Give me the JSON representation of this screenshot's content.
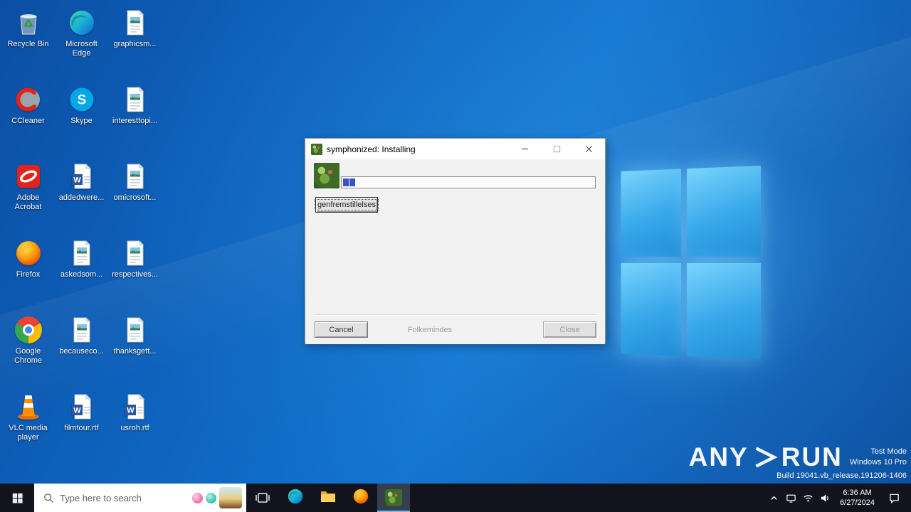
{
  "desktop": {
    "icons": [
      {
        "id": "recycle-bin",
        "label": "Recycle Bin",
        "icon": "recycle-bin-icon"
      },
      {
        "id": "microsoft-edge",
        "label": "Microsoft Edge",
        "icon": "edge-icon"
      },
      {
        "id": "graphicsm",
        "label": "graphicsm...",
        "icon": "image-doc-icon"
      },
      {
        "id": "ccleaner",
        "label": "CCleaner",
        "icon": "ccleaner-icon"
      },
      {
        "id": "skype",
        "label": "Skype",
        "icon": "skype-icon"
      },
      {
        "id": "interesttopi",
        "label": "interesttopi...",
        "icon": "image-doc-icon"
      },
      {
        "id": "adobe-acrobat",
        "label": "Adobe Acrobat",
        "icon": "acrobat-icon"
      },
      {
        "id": "addedwere",
        "label": "addedwere...",
        "icon": "word-doc-icon"
      },
      {
        "id": "omicrosoft",
        "label": "omicrosoft...",
        "icon": "image-doc-icon"
      },
      {
        "id": "firefox",
        "label": "Firefox",
        "icon": "firefox-icon"
      },
      {
        "id": "askedsom",
        "label": "askedsom...",
        "icon": "image-doc-icon"
      },
      {
        "id": "respectives",
        "label": "respectives...",
        "icon": "image-doc-icon"
      },
      {
        "id": "google-chrome",
        "label": "Google Chrome",
        "icon": "chrome-icon"
      },
      {
        "id": "becauseco",
        "label": "becauseco...",
        "icon": "image-doc-icon"
      },
      {
        "id": "thanksgett",
        "label": "thanksgett...",
        "icon": "image-doc-icon"
      },
      {
        "id": "vlc",
        "label": "VLC media player",
        "icon": "vlc-icon"
      },
      {
        "id": "filmtour",
        "label": "filmtour.rtf",
        "icon": "word-doc-icon"
      },
      {
        "id": "usroh",
        "label": "usroh.rtf",
        "icon": "word-doc-icon"
      }
    ]
  },
  "dialog": {
    "title": "symphonized: Installing",
    "progress_blocks": 2,
    "focus_button": "genfremstillelses",
    "footer": {
      "cancel": "Cancel",
      "middle": "Folkemindes",
      "close": "Close"
    }
  },
  "taskbar": {
    "search_placeholder": "Type here to search",
    "clock_time": "6:36 AM",
    "clock_date": "6/27/2024"
  },
  "watermark": {
    "brand_left": "ANY",
    "brand_right": "RUN",
    "line1": "Test Mode",
    "line2": "Windows 10 Pro",
    "line3": "Build 19041.vb_release.191206-1406"
  },
  "colors": {
    "desktop_blue": "#0e63bd",
    "logo_pane_blue": "#38aaeb",
    "progress_block_blue": "#3653c7",
    "taskbar_dark": "#12131d",
    "active_underline": "#7ab8e8"
  }
}
